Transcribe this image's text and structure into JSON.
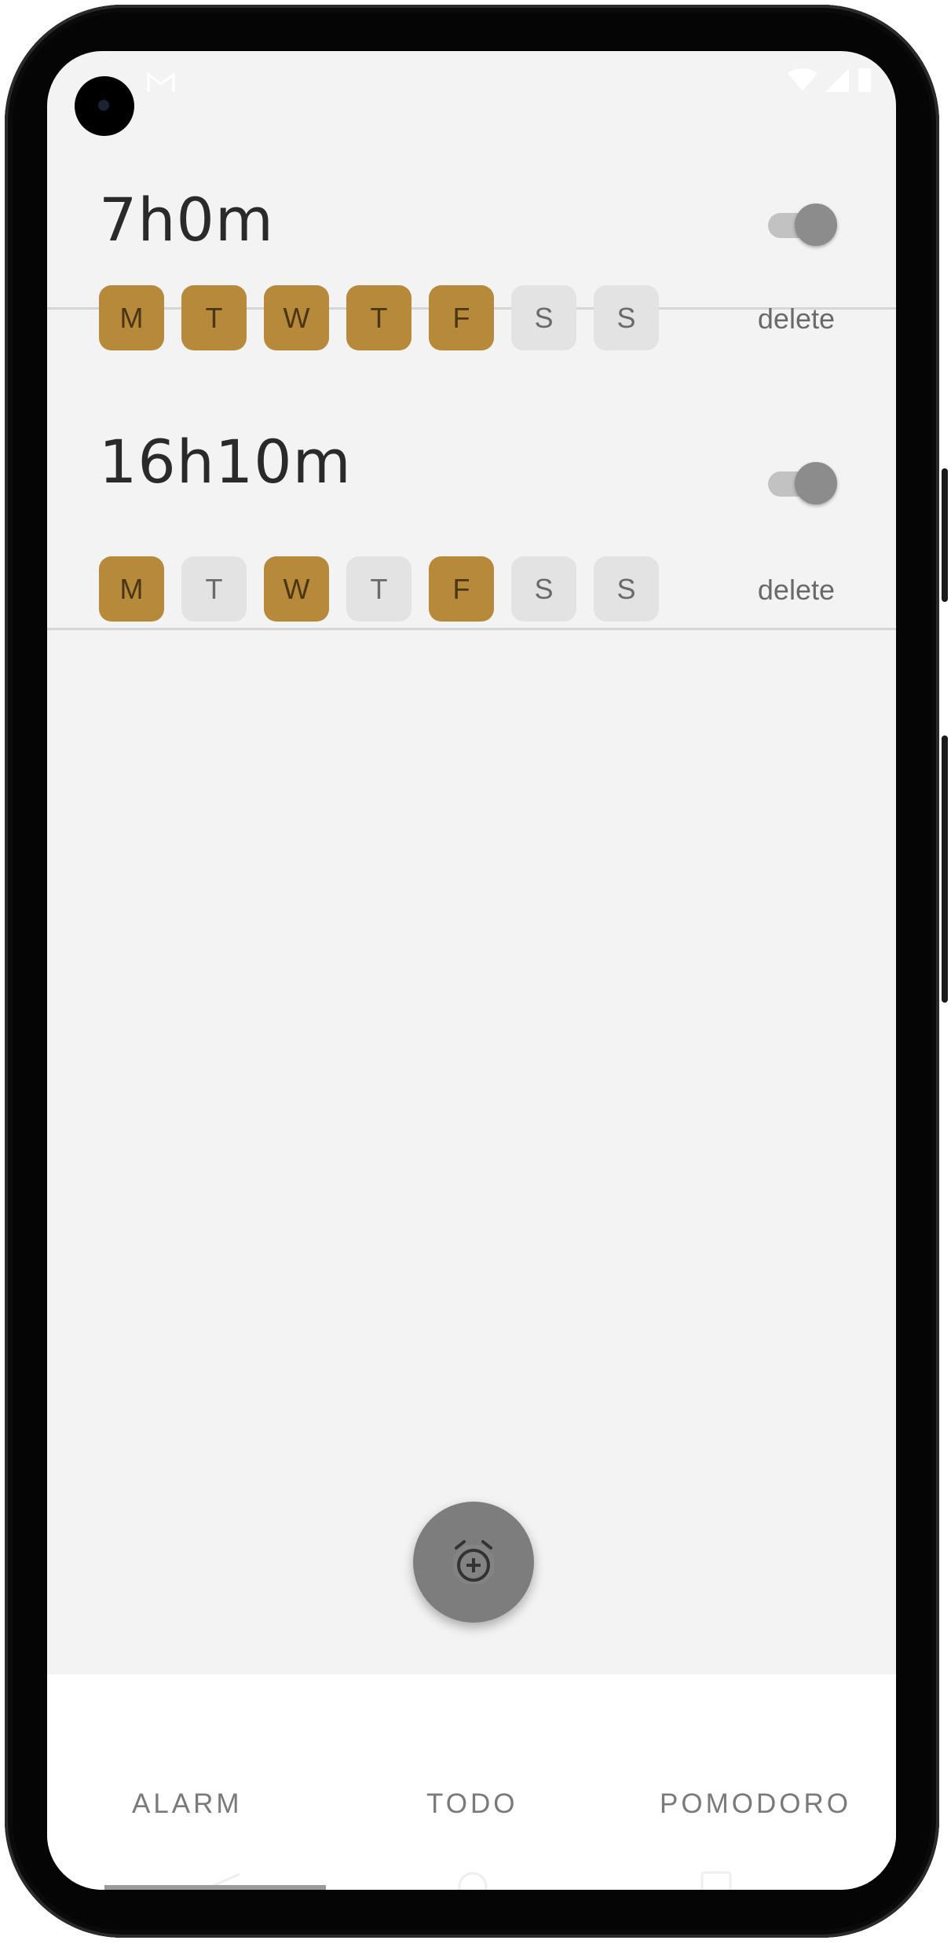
{
  "alarms": [
    {
      "time": "7h0m",
      "enabled": false,
      "days": [
        {
          "label": "M",
          "active": true
        },
        {
          "label": "T",
          "active": true
        },
        {
          "label": "W",
          "active": true
        },
        {
          "label": "T",
          "active": true
        },
        {
          "label": "F",
          "active": true
        },
        {
          "label": "S",
          "active": false
        },
        {
          "label": "S",
          "active": false
        }
      ],
      "delete_label": "delete"
    },
    {
      "time": "16h10m",
      "enabled": false,
      "days": [
        {
          "label": "M",
          "active": true
        },
        {
          "label": "T",
          "active": false
        },
        {
          "label": "W",
          "active": true
        },
        {
          "label": "T",
          "active": false
        },
        {
          "label": "F",
          "active": true
        },
        {
          "label": "S",
          "active": false
        },
        {
          "label": "S",
          "active": false
        }
      ],
      "delete_label": "delete"
    }
  ],
  "fab": {
    "icon": "alarm-add-icon"
  },
  "tabs": [
    {
      "label": "ALARM"
    },
    {
      "label": "TODO"
    },
    {
      "label": "POMODORO"
    }
  ],
  "colors": {
    "day_active": "#b6893b",
    "day_inactive": "#e3e3e3",
    "background": "#f3f3f3"
  }
}
